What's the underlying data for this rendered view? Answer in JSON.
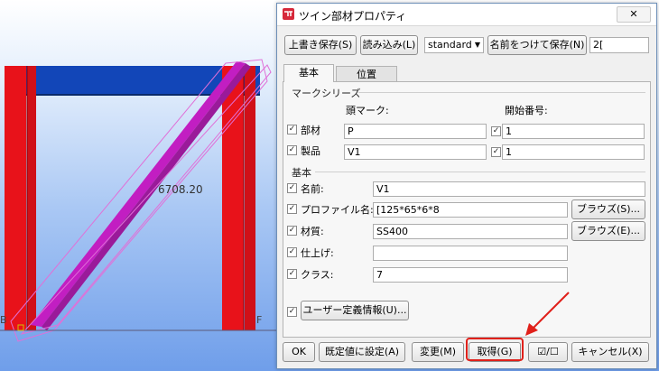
{
  "viewport": {
    "dimension_text": "6708.20",
    "grid_letter_left": "B",
    "grid_letter_right": "F"
  },
  "dialog": {
    "title": "ツイン部材プロパティ",
    "toolbar": {
      "overwrite_save": "上書き保存(S)",
      "load": "読み込み(L)",
      "preset_selected": "standard",
      "save_as": "名前をつけて保存(N)",
      "save_as_name": "2["
    },
    "tabs": [
      "基本",
      "位置"
    ],
    "mark_series": {
      "heading": "マークシリーズ",
      "col_prefix": "頭マーク:",
      "col_start": "開始番号:",
      "rows": [
        {
          "label": "部材",
          "prefix": "P",
          "start": "1"
        },
        {
          "label": "製品",
          "prefix": "V1",
          "start": "1"
        }
      ]
    },
    "basic": {
      "heading": "基本",
      "name_label": "名前:",
      "name_value": "V1",
      "profile_label": "プロファイル名:",
      "profile_value": "[125*65*6*8",
      "profile_browse": "ブラウズ(S)...",
      "material_label": "材質:",
      "material_value": "SS400",
      "material_browse": "ブラウズ(E)...",
      "finish_label": "仕上げ:",
      "finish_value": "",
      "class_label": "クラス:",
      "class_value": "7"
    },
    "udf_button": "ユーザー定義情報(U)...",
    "footer": {
      "ok": "OK",
      "set_default": "既定値に設定(A)",
      "modify": "変更(M)",
      "get": "取得(G)",
      "toggle": "☑/☐",
      "cancel": "キャンセル(X)"
    }
  },
  "colors": {
    "column_red": "#e8121a",
    "beam_blue": "#1246b8",
    "brace_magenta": "#c21ec2",
    "highlight_red": "#e0201a"
  }
}
